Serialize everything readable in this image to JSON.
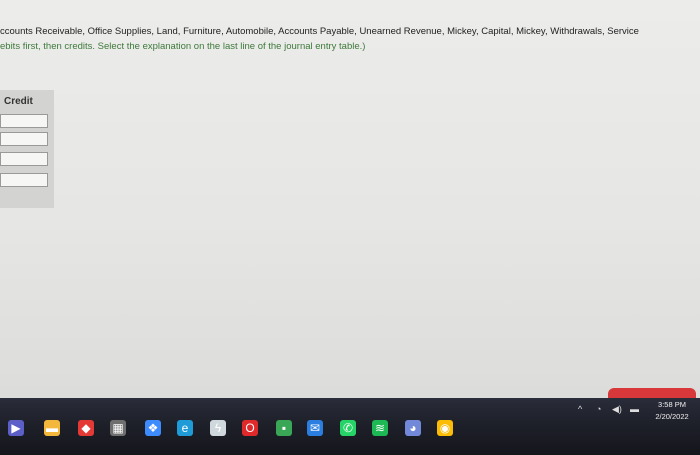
{
  "instructions": {
    "line1": "ccounts Receivable, Office Supplies, Land, Furniture, Automobile, Accounts Payable, Unearned Revenue, Mickey, Capital, Mickey, Withdrawals, Service",
    "line2": "ebits first, then credits. Select the explanation on the last line of the journal entry table.)"
  },
  "journal": {
    "credit_header": "Credit",
    "credit_fields": [
      "",
      "",
      "",
      ""
    ]
  },
  "taskbar": {
    "apps": [
      {
        "icon": "video-app-icon",
        "color": "#5b5fc7"
      },
      {
        "icon": "file-explorer-icon",
        "color": "#f3b73b"
      },
      {
        "icon": "red-diamond-app-icon",
        "color": "#e53935"
      },
      {
        "icon": "calculator-icon",
        "color": "#6f6f6f"
      },
      {
        "icon": "dropbox-icon",
        "color": "#3d8bfd"
      },
      {
        "icon": "edge-icon",
        "color": "#1f9cd8"
      },
      {
        "icon": "bolt-app-icon",
        "color": "#cfd8dc"
      },
      {
        "icon": "opera-icon",
        "color": "#e0292b"
      },
      {
        "icon": "green-app-icon",
        "color": "#3aa757"
      },
      {
        "icon": "mail-icon",
        "color": "#2a7ee0"
      },
      {
        "icon": "whatsapp-icon",
        "color": "#25d366"
      },
      {
        "icon": "spotify-icon",
        "color": "#1db954"
      },
      {
        "icon": "discord-icon",
        "color": "#7289da"
      },
      {
        "icon": "chrome-icon",
        "color": "#fbbc05"
      }
    ],
    "clock": {
      "time": "3:58 PM",
      "date": "2/20/2022"
    }
  }
}
